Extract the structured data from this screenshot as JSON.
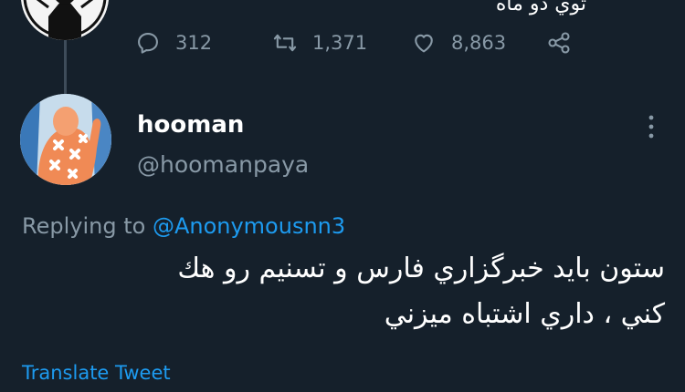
{
  "parent": {
    "text_fragment": "توي دو ماه"
  },
  "actions": {
    "reply_count": "312",
    "retweet_count": "1,371",
    "like_count": "8,863",
    "icons": [
      "reply-icon",
      "retweet-icon",
      "like-icon",
      "share-icon"
    ]
  },
  "reply": {
    "display_name": "hooman",
    "handle": "@hoomanpaya",
    "replying_prefix": "Replying to",
    "replying_mention": "@Anonymousnn3",
    "text_line1": "ستون بايد خبرگزاري فارس و تسنيم رو هك",
    "text_line2": "كني ، داري اشتباه ميزني",
    "translate_label": "Translate Tweet"
  },
  "colors": {
    "background": "#15202b",
    "muted": "#8899a6",
    "accent": "#1d9bf0",
    "text": "#ffffff"
  }
}
